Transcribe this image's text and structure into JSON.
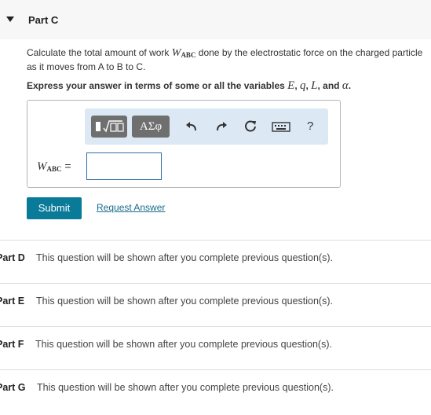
{
  "part_c": {
    "title": "Part C",
    "question_prefix": "Calculate the total amount of work ",
    "question_var": "W",
    "question_sub": "ABC",
    "question_suffix": " done by the electrostatic force on the charged particle as it moves from A to B to C.",
    "express_prefix": "Express your answer in terms of some or all the variables ",
    "express_vars": [
      "E",
      "q",
      "L",
      "α"
    ],
    "express_sep1": ", ",
    "express_sep2": ", ",
    "express_sep3": ", and ",
    "express_end": ".",
    "toolbar": {
      "templates_label": "▮√▯",
      "symbols_label": "ΑΣφ",
      "help_label": "?"
    },
    "input_label_var": "W",
    "input_label_sub": "ABC",
    "input_label_eq": " =",
    "input_value": "",
    "submit_label": "Submit",
    "request_label": "Request Answer"
  },
  "locked_parts": [
    {
      "label": "Part D",
      "message": "This question will be shown after you complete previous question(s)."
    },
    {
      "label": "Part E",
      "message": "This question will be shown after you complete previous question(s)."
    },
    {
      "label": "Part F",
      "message": "This question will be shown after you complete previous question(s)."
    },
    {
      "label": "Part G",
      "message": "This question will be shown after you complete previous question(s)."
    }
  ]
}
